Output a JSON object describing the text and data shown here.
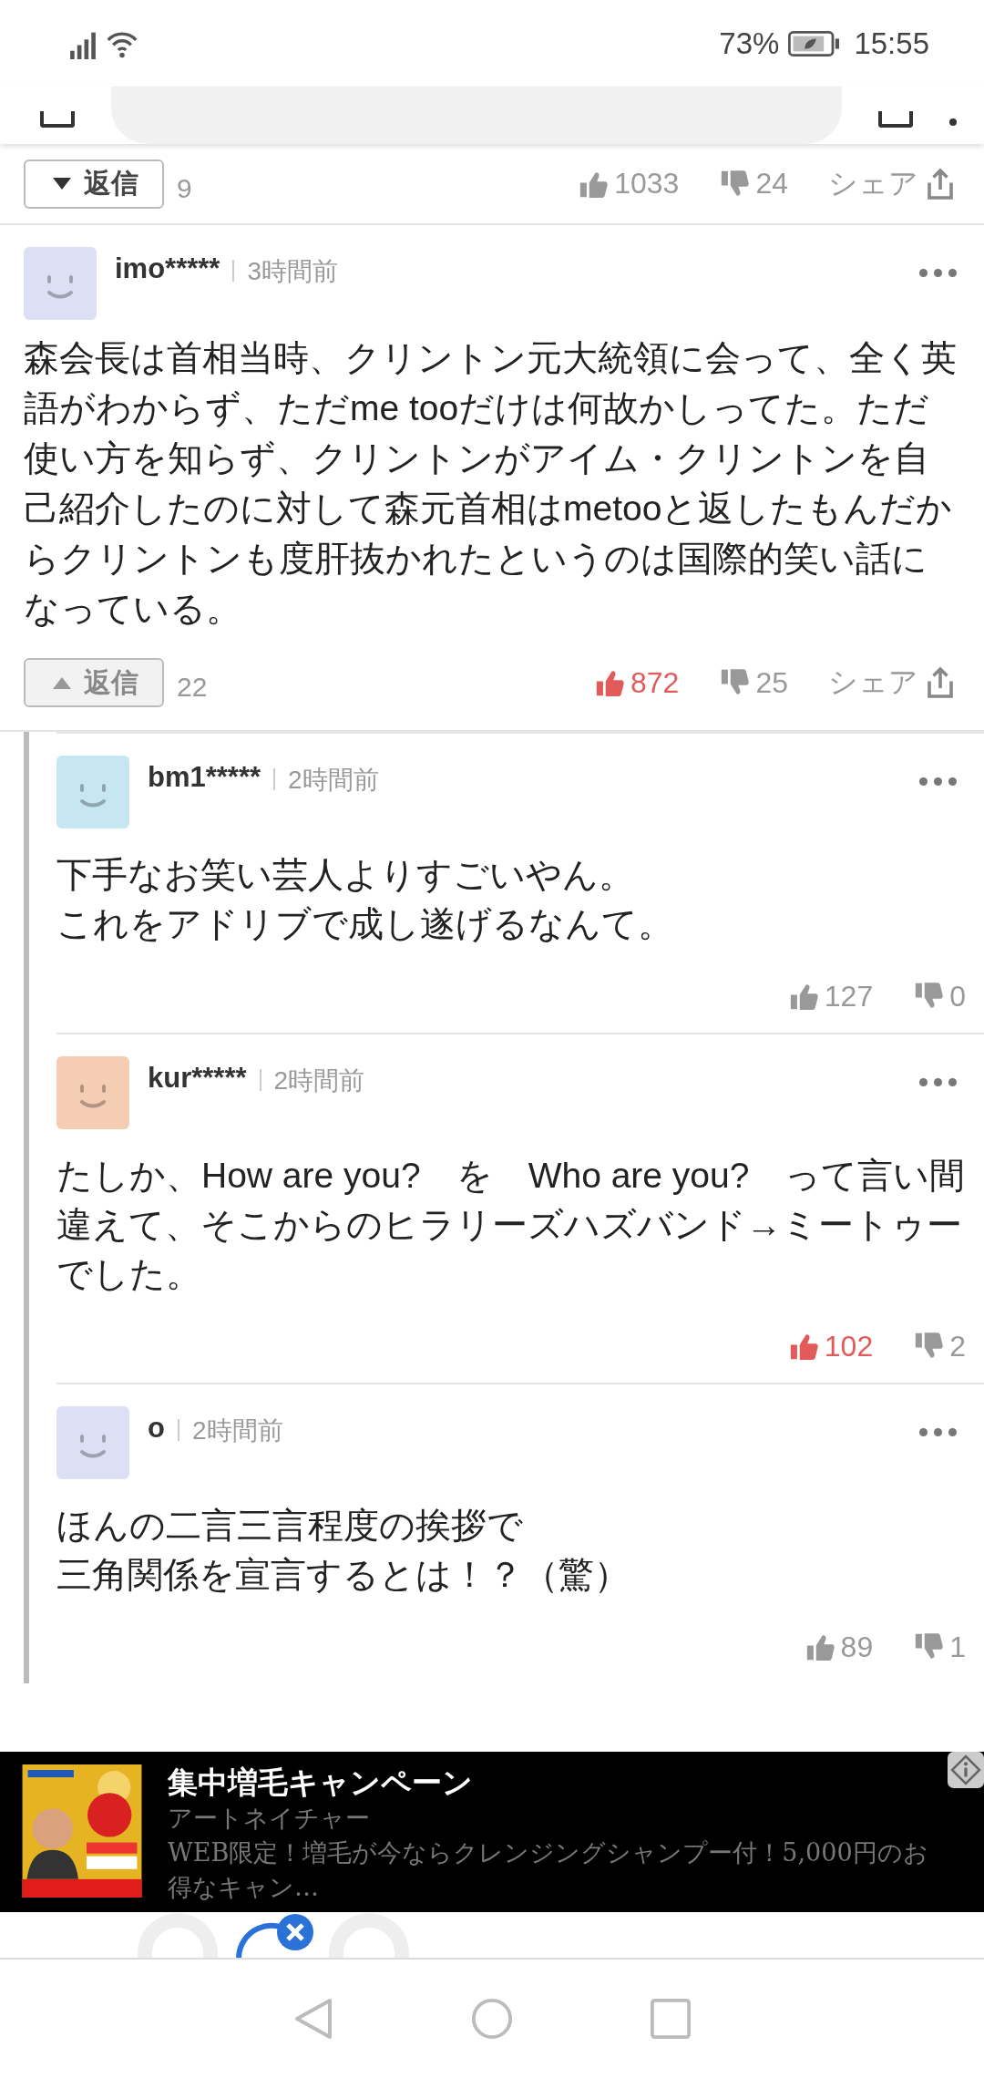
{
  "status_bar": {
    "battery": "73%",
    "time": "15:55"
  },
  "previous_comment_actions": {
    "reply_label": "返信",
    "reply_count": "9",
    "expanded": false,
    "likes": "1033",
    "liked": false,
    "dislikes": "24",
    "share": "シェア"
  },
  "comment": {
    "user": "imo*****",
    "time": "3時間前",
    "color": "#dde0f5",
    "body": "森会長は首相当時、クリントン元大統領に会って、全く英語がわからず、ただme tooだけは何故かしってた。ただ使い方を知らず、クリントンがアイム・クリントンを自己紹介したのに対して森元首相はmetooと返したもんだからクリントンも度肝抜かれたというのは国際的笑い話になっている。",
    "actions": {
      "reply_label": "返信",
      "reply_count": "22",
      "expanded": true,
      "likes": "872",
      "liked": true,
      "dislikes": "25",
      "share": "シェア"
    }
  },
  "replies": [
    {
      "user": "bm1*****",
      "time": "2時間前",
      "color": "#c6e6f2",
      "lines": [
        "下手なお笑い芸人よりすごいやん。",
        "これをアドリブで成し遂げるなんて。"
      ],
      "likes": "127",
      "liked": false,
      "dislikes": "0"
    },
    {
      "user": "kur*****",
      "time": "2時間前",
      "color": "#f5cdb3",
      "lines": [
        "たしか、How are you?　を　Who are you?　って言い間違えて、そこからのヒラリーズハズバンド→ミートゥーでした。"
      ],
      "likes": "102",
      "liked": true,
      "dislikes": "2"
    },
    {
      "user": "o",
      "time": "2時間前",
      "color": "#dde0f5",
      "lines": [
        "ほんの二言三言程度の挨拶で",
        "三角関係を宣言するとは！？（驚）"
      ],
      "likes": "89",
      "liked": false,
      "dislikes": "1"
    }
  ],
  "ad": {
    "kind": "picture",
    "title": "集中増毛キャンペーン",
    "advertiser": "アートネイチャー",
    "description": "WEB限定！増毛が今ならクレンジングシャンプー付！5,000円のお得なキャン…"
  }
}
